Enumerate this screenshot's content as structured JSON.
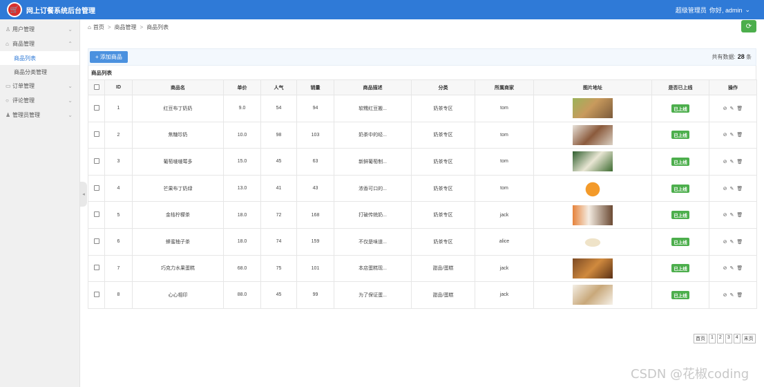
{
  "app": {
    "title": "网上订餐系统后台管理",
    "user_role": "超级管理员",
    "greeting": "你好, admin"
  },
  "sidebar": {
    "groups": [
      {
        "label": "用户管理",
        "icon": "user-icon",
        "expanded": false
      },
      {
        "label": "商品管理",
        "icon": "shop-icon",
        "expanded": true
      },
      {
        "label": "订单管理",
        "icon": "order-icon",
        "expanded": false
      },
      {
        "label": "评论管理",
        "icon": "comment-icon",
        "expanded": false
      },
      {
        "label": "管理员管理",
        "icon": "admin-icon",
        "expanded": false
      }
    ],
    "sub_items": [
      {
        "label": "商品列表",
        "active": true
      },
      {
        "label": "商品分类管理",
        "active": false
      }
    ]
  },
  "breadcrumb": [
    "首页",
    "商品管理",
    "商品列表"
  ],
  "toolbar": {
    "add_label": "+ 添加商品",
    "total_label": "共有数据:",
    "total_count": "28",
    "total_unit": "条"
  },
  "list_title": "商品列表",
  "table": {
    "headers": [
      "ID",
      "商品名",
      "单价",
      "人气",
      "销量",
      "商品描述",
      "分类",
      "所属商家",
      "图片地址",
      "是否已上线",
      "操作"
    ],
    "rows": [
      {
        "id": "1",
        "name": "红豆布丁奶奶",
        "price": "9.0",
        "popularity": "54",
        "sales": "94",
        "desc": "软糯红豆搬...",
        "category": "奶茶专区",
        "merchant": "tom",
        "status": "已上线"
      },
      {
        "id": "2",
        "name": "焦糖珍奶",
        "price": "10.0",
        "popularity": "98",
        "sales": "103",
        "desc": "奶茶中的经...",
        "category": "奶茶专区",
        "merchant": "tom",
        "status": "已上线"
      },
      {
        "id": "3",
        "name": "葡萄啵啵莓多",
        "price": "15.0",
        "popularity": "45",
        "sales": "63",
        "desc": "新鲜葡萄制...",
        "category": "奶茶专区",
        "merchant": "tom",
        "status": "已上线"
      },
      {
        "id": "4",
        "name": "芒果布丁奶绿",
        "price": "13.0",
        "popularity": "41",
        "sales": "43",
        "desc": "浓香可口的...",
        "category": "奶茶专区",
        "merchant": "tom",
        "status": "已上线"
      },
      {
        "id": "5",
        "name": "金桔柠檬茶",
        "price": "18.0",
        "popularity": "72",
        "sales": "168",
        "desc": "打破传统奶...",
        "category": "奶茶专区",
        "merchant": "jack",
        "status": "已上线"
      },
      {
        "id": "6",
        "name": "蜂蜜柚子茶",
        "price": "18.0",
        "popularity": "74",
        "sales": "159",
        "desc": "不仅是味道...",
        "category": "奶茶专区",
        "merchant": "alice",
        "status": "已上线"
      },
      {
        "id": "7",
        "name": "巧克力水果蛋糕",
        "price": "68.0",
        "popularity": "75",
        "sales": "101",
        "desc": "本店蛋糕现...",
        "category": "甜品/蛋糕",
        "merchant": "jack",
        "status": "已上线"
      },
      {
        "id": "8",
        "name": "心心相印",
        "price": "88.0",
        "popularity": "45",
        "sales": "99",
        "desc": "为了保证蛋...",
        "category": "甜品/蛋糕",
        "merchant": "jack",
        "status": "已上线"
      }
    ]
  },
  "pager": [
    "首页",
    "1",
    "2",
    "3",
    "4",
    "末页"
  ],
  "watermark": "CSDN @花椒coding",
  "colors": {
    "accent": "#2f7ad7",
    "success": "#4cae4c",
    "brand_red": "#d9302e"
  }
}
